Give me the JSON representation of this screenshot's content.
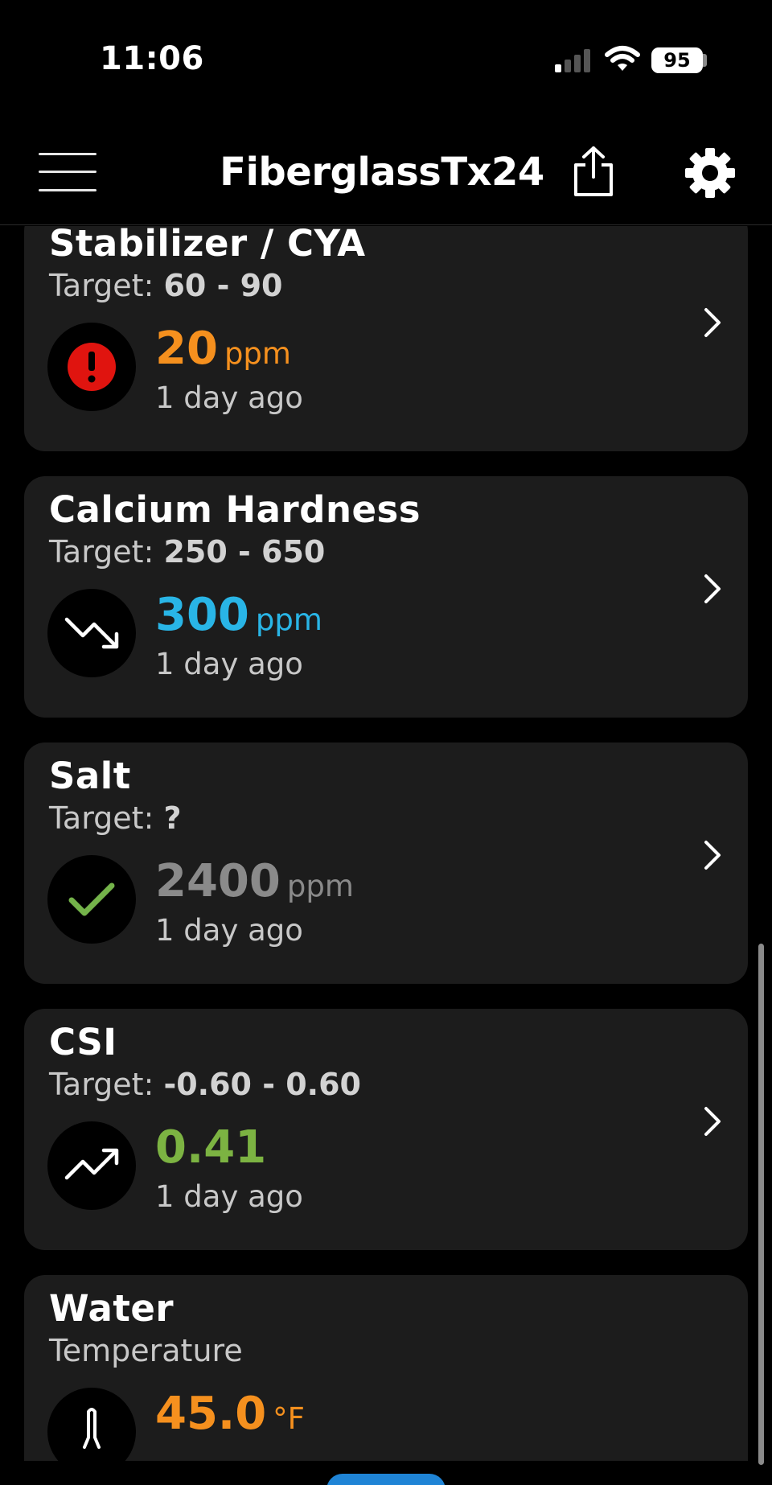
{
  "status_bar": {
    "time": "11:06",
    "battery": "95"
  },
  "nav": {
    "title": "FiberglassTx24"
  },
  "cards": [
    {
      "name": "Stabilizer / CYA",
      "target_label": "Target: ",
      "target_value": "60 - 90",
      "value": "20",
      "unit": "ppm",
      "time_ago": "1 day ago",
      "value_color": "#f5901e",
      "status_icon": "alert-icon"
    },
    {
      "name": "Calcium Hardness",
      "target_label": "Target: ",
      "target_value": "250 - 650",
      "value": "300",
      "unit": "ppm",
      "time_ago": "1 day ago",
      "value_color": "#29b5e6",
      "status_icon": "trend-down-icon"
    },
    {
      "name": "Salt",
      "target_label": "Target: ",
      "target_value": "?",
      "value": "2400",
      "unit": "ppm",
      "time_ago": "1 day ago",
      "value_color": "#8a8a8a",
      "status_icon": "check-icon"
    },
    {
      "name": "CSI",
      "target_label": "Target: ",
      "target_value": "-0.60 - 0.60",
      "value": "0.41",
      "unit": "",
      "time_ago": "1 day ago",
      "value_color": "#7cb342",
      "status_icon": "trend-up-icon"
    },
    {
      "name": "Water",
      "subtitle": "Temperature",
      "value": "45.0",
      "unit": "°F",
      "value_color": "#f5901e",
      "status_icon": "thermometer-icon"
    }
  ]
}
